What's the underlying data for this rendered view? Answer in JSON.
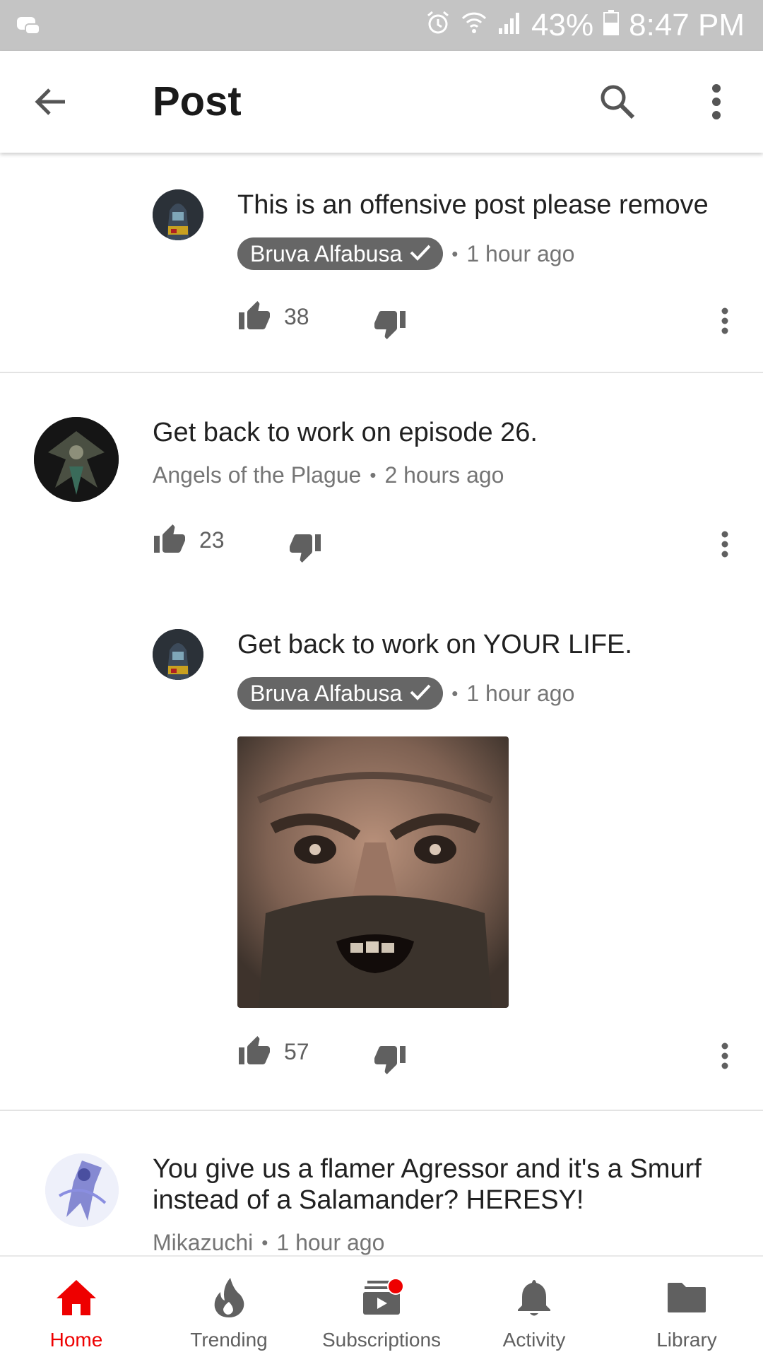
{
  "status_bar": {
    "battery": "43%",
    "time": "8:47 PM"
  },
  "app_bar": {
    "title": "Post"
  },
  "comments": [
    {
      "text": "This is an offensive post please remove",
      "author": "Bruva Alfabusa",
      "verified": true,
      "time": "1 hour ago",
      "likes": "38"
    },
    {
      "text": "Get back to work on episode 26.",
      "author": "Angels of the Plague",
      "verified": false,
      "time": "2 hours ago",
      "likes": "23"
    },
    {
      "text": "Get back to work on YOUR LIFE.",
      "author": "Bruva Alfabusa",
      "verified": true,
      "time": "1 hour ago",
      "likes": "57"
    },
    {
      "text_line1": "You give us a flamer Agressor and it's a Smurf",
      "text_line2": "instead of a Salamander? HERESY!",
      "author": "Mikazuchi",
      "verified": false,
      "time": "1 hour ago"
    }
  ],
  "separator": "•",
  "bottom_nav": {
    "home": "Home",
    "trending": "Trending",
    "subscriptions": "Subscriptions",
    "activity": "Activity",
    "library": "Library"
  },
  "colors": {
    "accent": "#ee0000",
    "status_bar_bg": "#c4c4c4",
    "badge_bg": "#666666",
    "text_primary": "#212121",
    "text_secondary": "#757575"
  }
}
